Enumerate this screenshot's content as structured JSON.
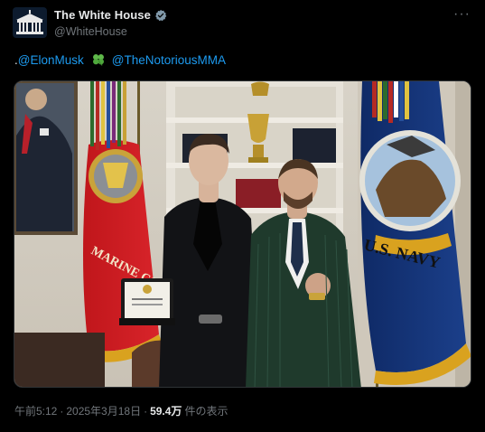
{
  "account": {
    "name": "The White House",
    "handle": "@WhiteHouse"
  },
  "tweet": {
    "prefix": ".",
    "mention_1": "@ElonMusk",
    "emoji": "four-leaf-clover",
    "mention_2": "@TheNotoriousMMA"
  },
  "photo": {
    "flag_text_left": "MARINE CORPS",
    "flag_text_right": "U.S. NAVY"
  },
  "meta": {
    "time": "午前5:12",
    "separator": "·",
    "date": "2025年3月18日",
    "separator_2": "·",
    "views_count": "59.4万",
    "views_label": "件の表示"
  },
  "colors": {
    "background": "#000000",
    "text": "#e7e9ea",
    "secondary": "#71767b",
    "link": "#1d9bf0",
    "verified": "#829aab"
  }
}
